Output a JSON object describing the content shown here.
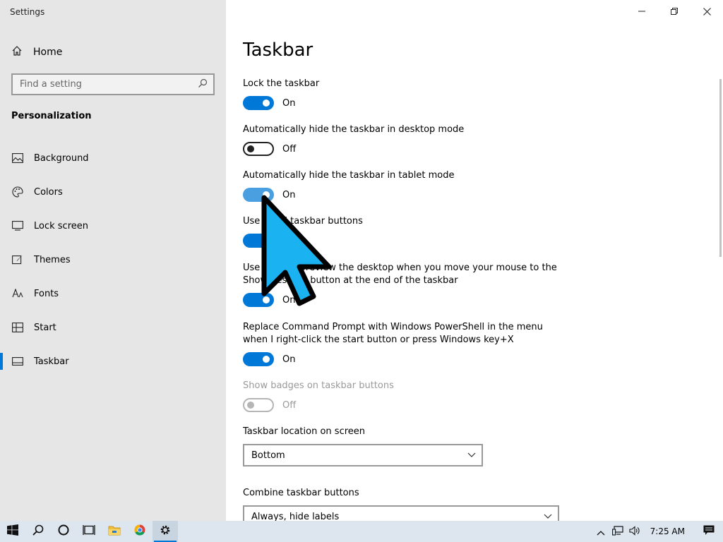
{
  "window": {
    "title": "Settings"
  },
  "sidebar": {
    "home_label": "Home",
    "search_placeholder": "Find a setting",
    "section_title": "Personalization",
    "items": [
      {
        "label": "Background",
        "icon": "image-icon"
      },
      {
        "label": "Colors",
        "icon": "palette-icon"
      },
      {
        "label": "Lock screen",
        "icon": "monitor-icon"
      },
      {
        "label": "Themes",
        "icon": "brush-icon"
      },
      {
        "label": "Fonts",
        "icon": "font-icon"
      },
      {
        "label": "Start",
        "icon": "start-grid-icon"
      },
      {
        "label": "Taskbar",
        "icon": "taskbar-icon",
        "active": true
      }
    ]
  },
  "main": {
    "title": "Taskbar",
    "settings": [
      {
        "label": "Lock the taskbar",
        "state": "On"
      },
      {
        "label": "Automatically hide the taskbar in desktop mode",
        "state": "Off"
      },
      {
        "label": "Automatically hide the taskbar in tablet mode",
        "state": "On"
      },
      {
        "label": "Use small taskbar buttons",
        "state": "On"
      },
      {
        "label": "Use Peek to preview the desktop when you move your mouse to the",
        "label2": "Show desktop button at the end of the taskbar",
        "state": "On"
      },
      {
        "label": "Replace Command Prompt with Windows PowerShell in the menu",
        "label2": "when I right-click the start button or press Windows key+X",
        "state": "On"
      },
      {
        "label": "Show badges on taskbar buttons",
        "state": "Off",
        "disabled": true
      }
    ],
    "location": {
      "label": "Taskbar location on screen",
      "value": "Bottom"
    },
    "combine": {
      "label": "Combine taskbar buttons",
      "value": "Always, hide labels"
    }
  },
  "taskbar": {
    "time": "7:25 AM"
  },
  "colors": {
    "accent": "#0078d7",
    "sidebar_bg": "#e6e6e6",
    "taskbar_bg": "#dde6ef",
    "cursor_fill": "#1ab2f0"
  }
}
